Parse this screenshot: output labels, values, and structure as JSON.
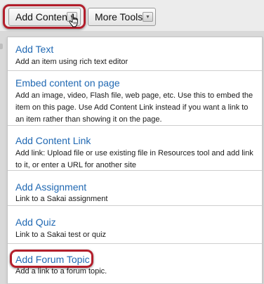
{
  "toolbar": {
    "add_content_label": "Add Content",
    "more_tools_label": "More Tools",
    "dropdown_arrow": "▼"
  },
  "menu": {
    "items": [
      {
        "title": "Add Text",
        "description": "Add an item using rich text editor"
      },
      {
        "title": "Embed content on page",
        "description": "Add an image, video, Flash file, web page, etc. Use this to embed the item on this page. Use Add Content Link instead if you want a link to an item rather than showing it on the page."
      },
      {
        "title": "Add Content Link",
        "description": "Add link: Upload file or use existing file in Resources tool and add link to it, or enter a URL for another site"
      },
      {
        "title": "Add Assignment",
        "description": "Link to a Sakai assignment"
      },
      {
        "title": "Add Quiz",
        "description": "Link to a Sakai test or quiz"
      },
      {
        "title": "Add Forum Topic",
        "description": "Add a link to a forum topic."
      }
    ]
  },
  "icons": {
    "cursor": "hand-pointer-icon",
    "arrow": "chevron-down-icon"
  },
  "colors": {
    "link": "#2169b3",
    "highlight_ring": "#b31e2b",
    "toolbar_bg": "#ececec"
  }
}
